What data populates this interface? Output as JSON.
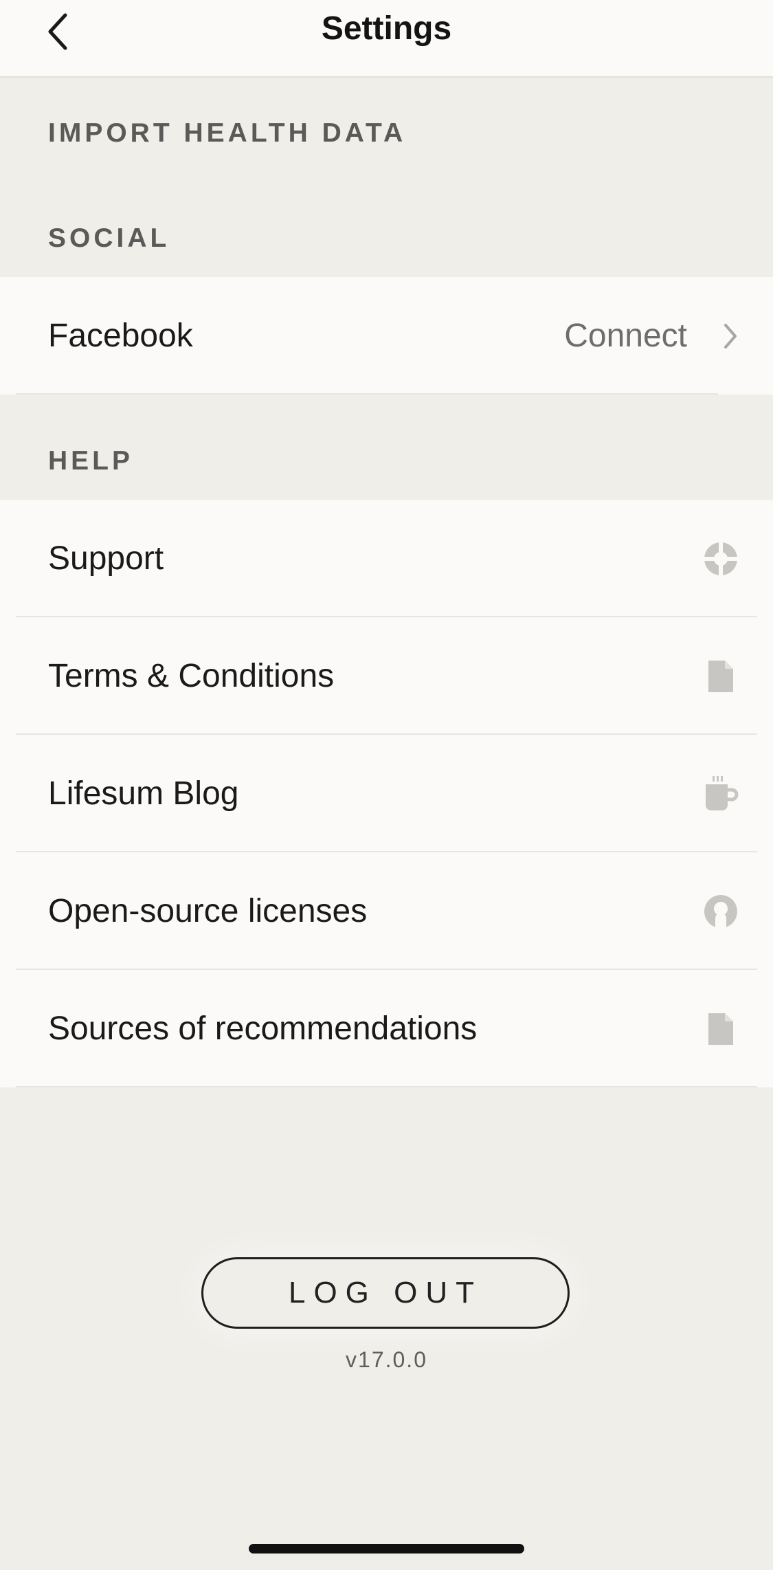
{
  "header": {
    "title": "Settings"
  },
  "sections": {
    "import": {
      "title": "IMPORT HEALTH DATA"
    },
    "social": {
      "title": "SOCIAL"
    },
    "help": {
      "title": "HELP"
    }
  },
  "social_rows": [
    {
      "label": "Facebook",
      "value": "Connect",
      "icon": "chevron-right-icon"
    }
  ],
  "help_rows": [
    {
      "label": "Support",
      "icon": "support-icon"
    },
    {
      "label": "Terms & Conditions",
      "icon": "document-icon"
    },
    {
      "label": "Lifesum Blog",
      "icon": "coffee-mug-icon"
    },
    {
      "label": "Open-source licenses",
      "icon": "github-icon"
    },
    {
      "label": "Sources of recommendations",
      "icon": "document-icon"
    }
  ],
  "footer": {
    "logout_label": "LOG OUT",
    "version": "v17.0.0"
  },
  "colors": {
    "background": "#f0eee9",
    "surface": "#fbfaf8",
    "icon": "#c8c6c2"
  }
}
